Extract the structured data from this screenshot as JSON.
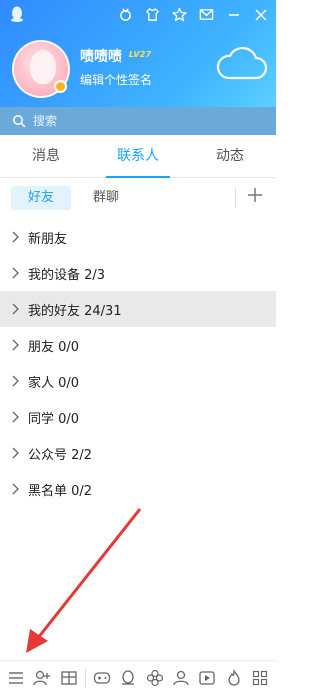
{
  "header": {
    "username": "啧啧啧",
    "level_badge": "LV27",
    "signature": "编辑个性签名",
    "top_icons": [
      "badge-icon",
      "shirt-icon",
      "star-icon",
      "mail-icon",
      "minimize-icon",
      "close-icon"
    ]
  },
  "search": {
    "placeholder": "搜索"
  },
  "tabs": [
    {
      "label": "消息",
      "active": false
    },
    {
      "label": "联系人",
      "active": true
    },
    {
      "label": "动态",
      "active": false
    }
  ],
  "subtabs": {
    "friends": "好友",
    "groups": "群聊"
  },
  "groups": [
    {
      "label": "新朋友"
    },
    {
      "label": "我的设备 2/3"
    },
    {
      "label": "我的好友 24/31",
      "highlighted": true
    },
    {
      "label": "朋友 0/0"
    },
    {
      "label": "家人 0/0"
    },
    {
      "label": "同学 0/0"
    },
    {
      "label": "公众号 2/2"
    },
    {
      "label": "黑名单 0/2"
    }
  ],
  "bottom_icons": [
    "menu-icon",
    "add-friend-icon",
    "app-manager-icon",
    "game-icon",
    "penguin-icon",
    "flower-icon",
    "contacts-icon",
    "video-icon",
    "fire-icon",
    "apps-grid-icon"
  ],
  "colors": {
    "header_start": "#2f8bff",
    "header_end": "#5bd0ff",
    "accent": "#1aa3ff",
    "search_bar": "#6ba9d9",
    "arrow": "#e53935"
  }
}
